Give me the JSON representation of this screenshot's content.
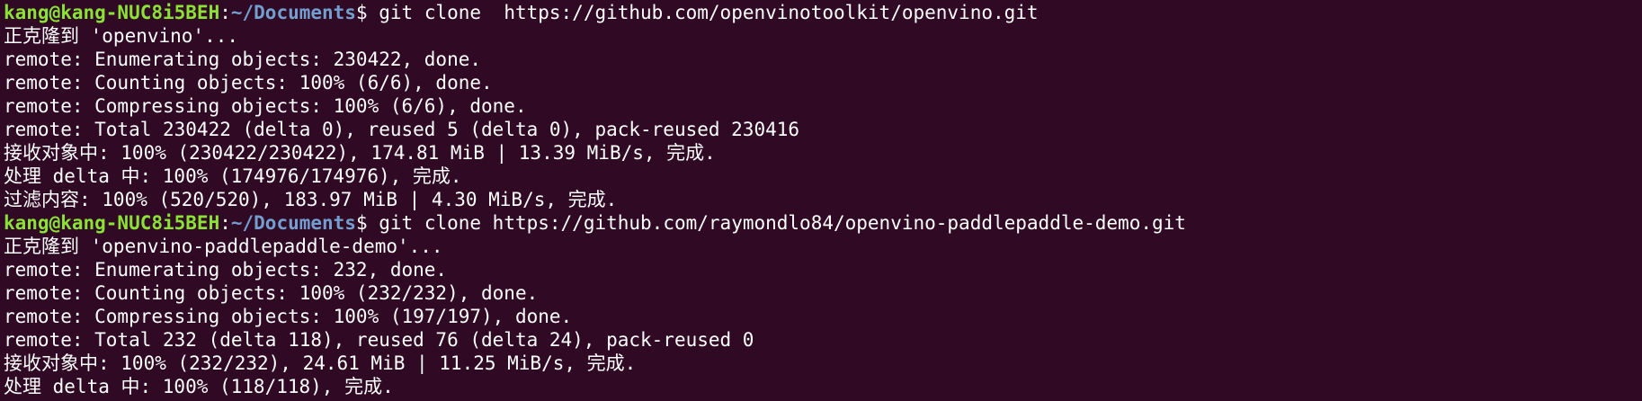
{
  "prompt": {
    "user_host": "kang@kang-NUC8i5BEH",
    "separator": ":",
    "path": "~/Documents",
    "symbol": "$"
  },
  "colors": {
    "background": "#300a24",
    "foreground": "#ffffff",
    "user_host": "#8ae234",
    "path": "#729fcf"
  },
  "blocks": [
    {
      "command": " git clone  https://github.com/openvinotoolkit/openvino.git",
      "output": [
        "正克隆到 'openvino'...",
        "remote: Enumerating objects: 230422, done.",
        "remote: Counting objects: 100% (6/6), done.",
        "remote: Compressing objects: 100% (6/6), done.",
        "remote: Total 230422 (delta 0), reused 5 (delta 0), pack-reused 230416",
        "接收对象中: 100% (230422/230422), 174.81 MiB | 13.39 MiB/s, 完成.",
        "处理 delta 中: 100% (174976/174976), 完成.",
        "过滤内容: 100% (520/520), 183.97 MiB | 4.30 MiB/s, 完成."
      ]
    },
    {
      "command": " git clone https://github.com/raymondlo84/openvino-paddlepaddle-demo.git",
      "output": [
        "正克隆到 'openvino-paddlepaddle-demo'...",
        "remote: Enumerating objects: 232, done.",
        "remote: Counting objects: 100% (232/232), done.",
        "remote: Compressing objects: 100% (197/197), done.",
        "remote: Total 232 (delta 118), reused 76 (delta 24), pack-reused 0",
        "接收对象中: 100% (232/232), 24.61 MiB | 11.25 MiB/s, 完成.",
        "处理 delta 中: 100% (118/118), 完成."
      ]
    }
  ]
}
